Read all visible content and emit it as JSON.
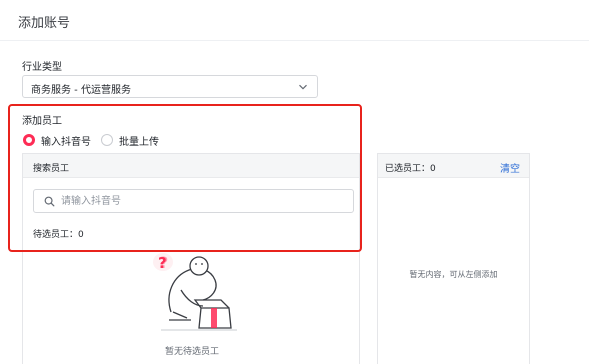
{
  "page": {
    "title": "添加账号"
  },
  "industry": {
    "label": "行业类型",
    "selected": "商务服务 - 代运营服务"
  },
  "employees": {
    "section_label": "添加员工",
    "input_modes": [
      {
        "label": "输入抖音号",
        "checked": true
      },
      {
        "label": "批量上传",
        "checked": false
      }
    ],
    "search_panel": {
      "header": "搜索员工",
      "search_placeholder": "请输入抖音号",
      "pending_count_text": "待选员工：0",
      "empty_text": "暂无待选员工"
    },
    "selected_panel": {
      "header": "已选员工：0",
      "clear_label": "清空",
      "empty_text": "暂无内容，可从左侧添加"
    }
  },
  "colors": {
    "accent": "#fe2c55",
    "highlight_border": "#e8231c",
    "link": "#2b6cd6"
  },
  "icons": {
    "select_arrow": "chevron-down-icon",
    "search": "search-icon",
    "empty_illustration": "empty-state-illustration"
  }
}
